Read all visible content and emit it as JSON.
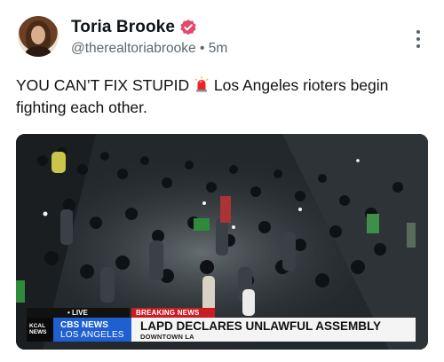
{
  "post": {
    "author": {
      "display_name": "Toria Brooke",
      "handle": "@therealtoriabrooke",
      "separator": "•",
      "time": "5m",
      "verified": true
    },
    "text_before_emoji": "YOU CAN’T FIX STUPID",
    "emoji": "siren-emoji",
    "text_after_emoji": " Los Angeles rioters begin fighting each other.",
    "media": {
      "type": "video-still",
      "overlay": {
        "live_label": "• LIVE",
        "breaking_label": "BREAKING NEWS",
        "station_logo": "KCAL NEWS",
        "network_top": "CBS NEWS",
        "network_bottom": "LOS ANGELES",
        "headline": "LAPD DECLARES UNLAWFUL ASSEMBLY",
        "subhead": "DOWNTOWN LA"
      }
    }
  },
  "icons": {
    "verified": "verified-badge-icon",
    "more": "more-vertical-icon"
  },
  "colors": {
    "verified": "#e3496e",
    "breaking": "#c81d25",
    "cbs_blue": "#1f5fd0",
    "handle_gray": "#5b6670"
  }
}
